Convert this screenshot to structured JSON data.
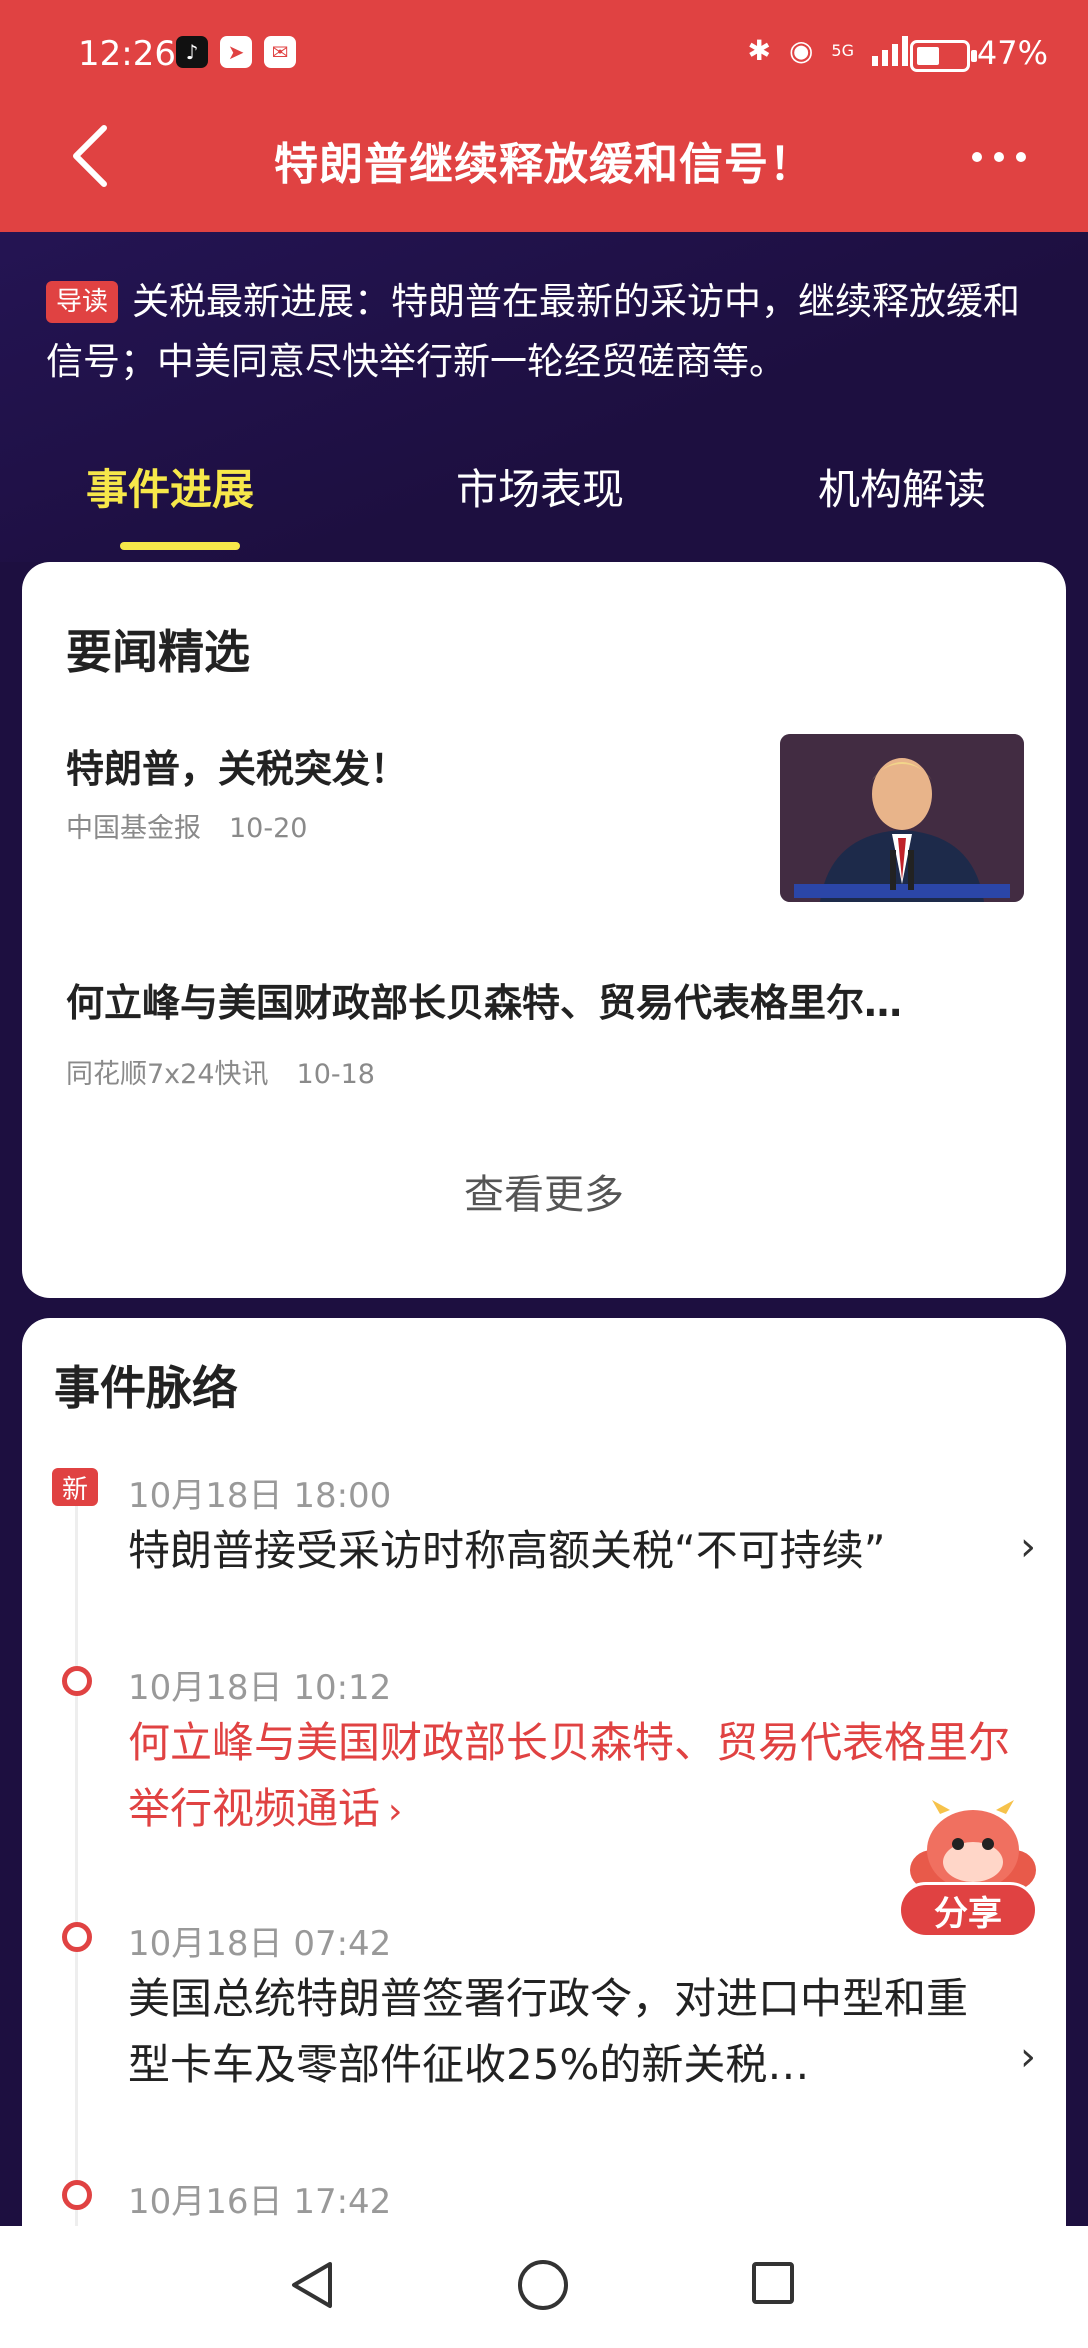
{
  "status_bar": {
    "time": "12:26",
    "network": "5G",
    "battery": "47%",
    "battery_level": 0.47
  },
  "header": {
    "title": "特朗普继续释放缓和信号！"
  },
  "lead": {
    "tag": "导读",
    "text": "关税最新进展：特朗普在最新的采访中，继续释放缓和信号；中美同意尽快举行新一轮经贸磋商等。"
  },
  "tabs": [
    {
      "label": "事件进展",
      "active": true
    },
    {
      "label": "市场表现",
      "active": false
    },
    {
      "label": "机构解读",
      "active": false
    }
  ],
  "news_card": {
    "title": "要闻精选",
    "items": [
      {
        "title": "特朗普，关税突发！",
        "source": "中国基金报",
        "date": "10-20"
      },
      {
        "title": "何立峰与美国财政部长贝森特、贸易代表格里尔…",
        "source": "同花顺7x24快讯",
        "date": "10-18"
      }
    ],
    "more_label": "查看更多"
  },
  "timeline_card": {
    "title": "事件脉络",
    "new_badge": "新",
    "events": [
      {
        "time": "10月18日 18:00",
        "text": "特朗普接受采访时称高额关税“不可持续”"
      },
      {
        "time": "10月18日 10:12",
        "text": "何立峰与美国财政部长贝森特、贸易代表格里尔举行视频通话"
      },
      {
        "time": "10月18日 07:42",
        "text": "美国总统特朗普签署行政令，对进口中型和重型卡车及零部件征收25%的新关税…"
      },
      {
        "time": "10月16日 17:42",
        "text": ""
      }
    ]
  },
  "share": {
    "label": "分享"
  },
  "colors": {
    "accent": "#e04242",
    "banner": "#1d0f40",
    "tab_active": "#f7e84a"
  }
}
